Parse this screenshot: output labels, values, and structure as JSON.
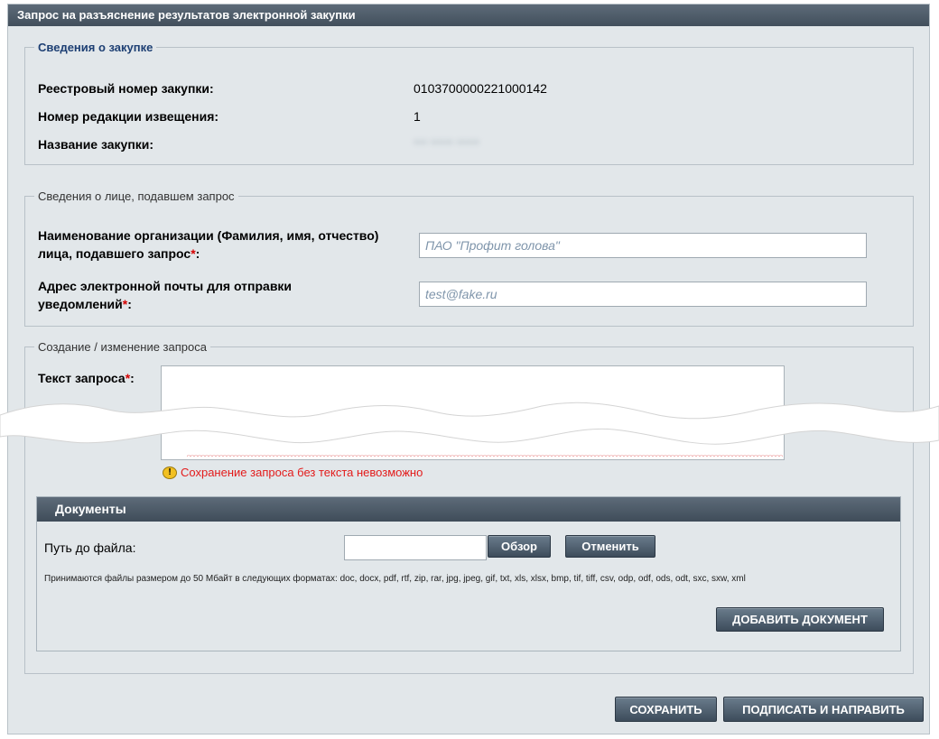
{
  "window": {
    "title": "Запрос на разъяснение результатов электронной закупки"
  },
  "purchase": {
    "legend": "Сведения о закупке",
    "reg_number_label": "Реестровый номер закупки:",
    "reg_number_value": "0103700000221000142",
    "revision_label": "Номер редакции извещения:",
    "revision_value": "1",
    "name_label": "Название закупки:",
    "name_value": "*** ***** *****"
  },
  "requester": {
    "legend": "Сведения о лице, подавшем запрос",
    "org_label": "Наименование организации (Фамилия, имя, отчество) лица, подавшего запрос",
    "org_placeholder": "ПАО \"Профит голова\"",
    "email_label": "Адрес электронной почты для отправки уведомлений",
    "email_placeholder": "test@fake.ru",
    "required_mark": "*",
    "colon": ":"
  },
  "request": {
    "legend": "Создание / изменение запроса",
    "text_label": "Текст запроса",
    "error": "Сохранение запроса без текста невозможно",
    "warn_glyph": "!"
  },
  "documents": {
    "title": "Документы",
    "path_label": "Путь до файла:",
    "browse_button": "Обзор",
    "cancel_button": "Отменить",
    "formats_note": "Принимаются файлы размером до 50 Мбайт в следующих форматах: doc, docx, pdf, rtf, zip, rar, jpg, jpeg, gif, txt, xls, xlsx, bmp, tif, tiff, csv, odp, odf, ods, odt, sxc, sxw, xml",
    "add_button": "ДОБАВИТЬ ДОКУМЕНТ"
  },
  "actions": {
    "save_button": "СОХРАНИТЬ",
    "sign_button": "ПОДПИСАТЬ И НАПРАВИТЬ"
  },
  "colors": {
    "header_bg": "#4c5a68",
    "panel_bg": "#e2e7ea",
    "required": "#d40000",
    "error_text": "#e31b1b",
    "legend_blue": "#1d3f73"
  }
}
